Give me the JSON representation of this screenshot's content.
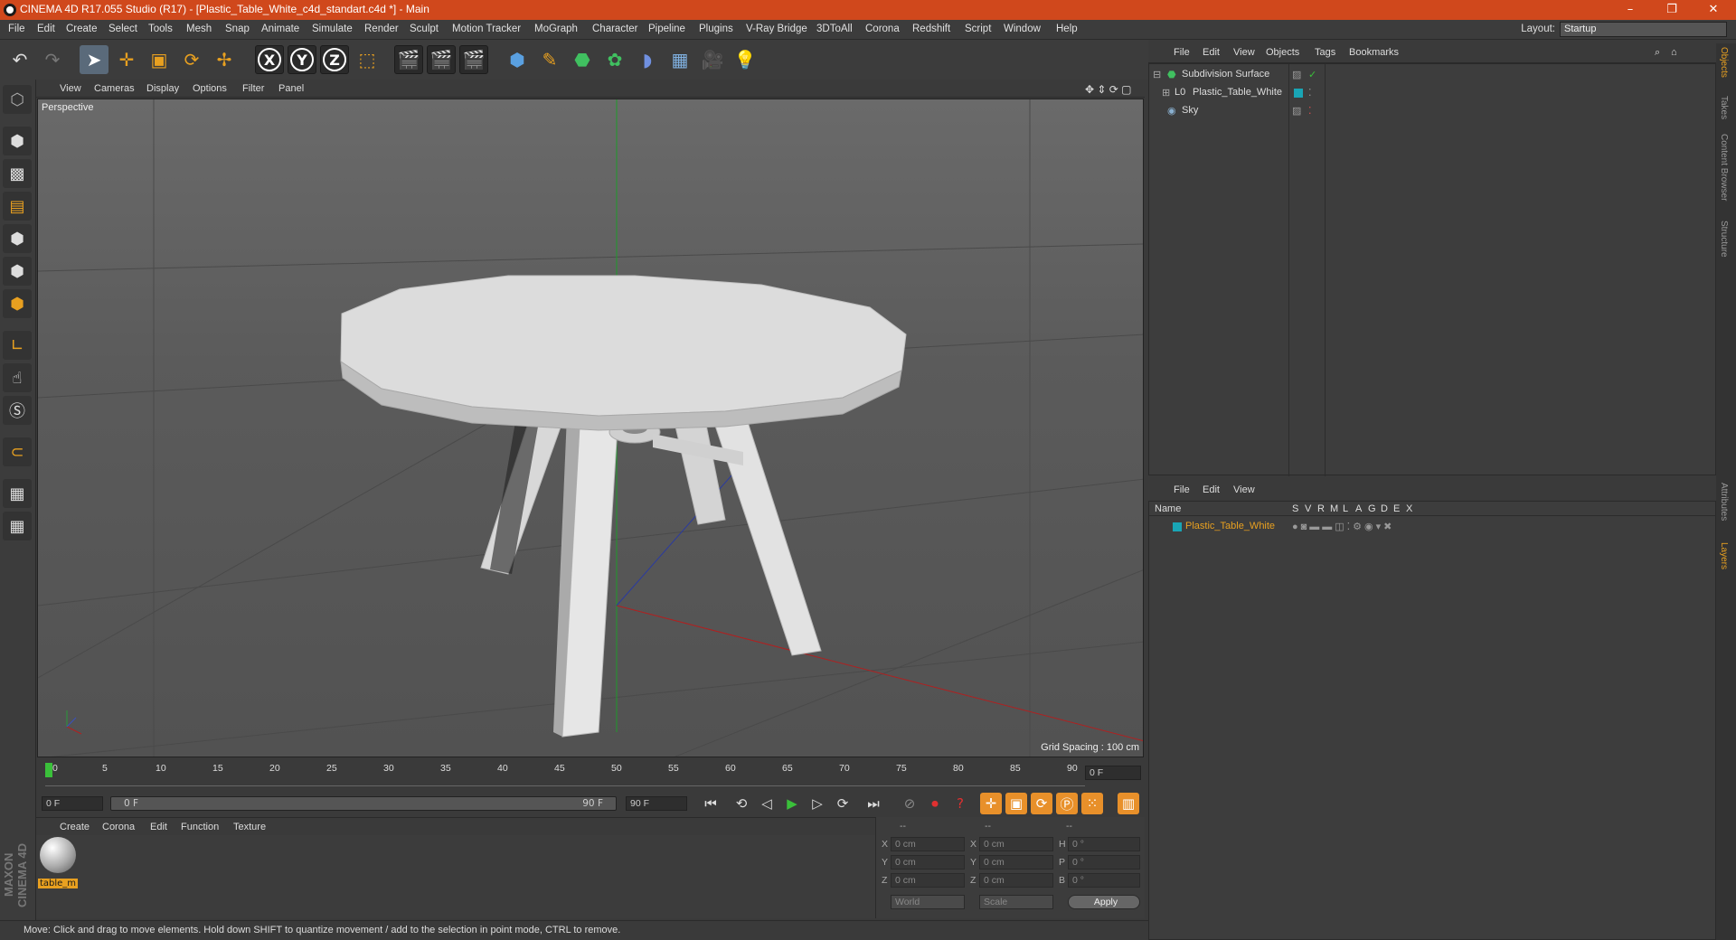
{
  "title": "CINEMA 4D R17.055 Studio (R17) - [Plastic_Table_White_c4d_standart.c4d *] - Main",
  "window_buttons": [
    "–",
    "❐",
    "✕"
  ],
  "menu": [
    "File",
    "Edit",
    "Create",
    "Select",
    "Tools",
    "Mesh",
    "Snap",
    "Animate",
    "Simulate",
    "Render",
    "Sculpt",
    "Motion Tracker",
    "MoGraph",
    "Character",
    "Pipeline",
    "Plugins",
    "V-Ray Bridge",
    "3DToAll",
    "Corona",
    "Redshift",
    "Script",
    "Window",
    "Help"
  ],
  "layout": {
    "label": "Layout:",
    "value": "Startup"
  },
  "toolbar_axes": [
    "X",
    "Y",
    "Z"
  ],
  "viewport": {
    "menu": [
      "View",
      "Cameras",
      "Display",
      "Options",
      "Filter",
      "Panel"
    ],
    "label": "Perspective",
    "grid_spacing": "Grid Spacing : 100 cm"
  },
  "timeline": {
    "ticks": [
      "0",
      "5",
      "10",
      "15",
      "20",
      "25",
      "30",
      "35",
      "40",
      "45",
      "50",
      "55",
      "60",
      "65",
      "70",
      "75",
      "80",
      "85",
      "90"
    ],
    "current_frame": "0 F",
    "start": "0 F",
    "range_start": "0 F",
    "range_end": "90 F",
    "end": "90 F"
  },
  "material_menu": [
    "Create",
    "Corona",
    "Edit",
    "Function",
    "Texture"
  ],
  "material": {
    "name": "table_m"
  },
  "coords": {
    "headers": [
      "--",
      "--",
      "--"
    ],
    "rows": [
      {
        "a": "X",
        "av": "0 cm",
        "b": "X",
        "bv": "0 cm",
        "c": "H",
        "cv": "0 °"
      },
      {
        "a": "Y",
        "av": "0 cm",
        "b": "Y",
        "bv": "0 cm",
        "c": "P",
        "cv": "0 °"
      },
      {
        "a": "Z",
        "av": "0 cm",
        "b": "Z",
        "bv": "0 cm",
        "c": "B",
        "cv": "0 °"
      }
    ],
    "mode": "World",
    "scale": "Scale",
    "apply": "Apply"
  },
  "objects_menu": [
    "File",
    "Edit",
    "View",
    "Objects",
    "Tags",
    "Bookmarks"
  ],
  "objects": [
    {
      "name": "Subdivision Surface"
    },
    {
      "name": "Plastic_Table_White"
    },
    {
      "name": "Sky"
    }
  ],
  "layers_menu": [
    "File",
    "Edit",
    "View"
  ],
  "layers_columns": [
    "Name",
    "S",
    "V",
    "R",
    "M",
    "L",
    "A",
    "G",
    "D",
    "E",
    "X"
  ],
  "layer": {
    "name": "Plastic_Table_White"
  },
  "side_tabs": [
    "Objects",
    "Takes",
    "Content Browser",
    "Structure",
    "Attributes",
    "Layers"
  ],
  "brand": "MAXON CINEMA 4D",
  "status": "Move: Click and drag to move elements. Hold down SHIFT to quantize movement / add to the selection in point mode, CTRL to remove.",
  "colors": {
    "titlebar": "#d0481c",
    "accent": "#e8902a",
    "layer_name": "#e8a020",
    "teal": "#19a5b5"
  }
}
